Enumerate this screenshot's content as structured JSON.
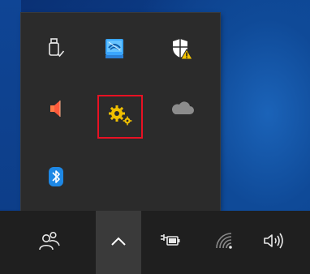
{
  "tray_overflow": {
    "icons": [
      {
        "name": "usb-safely-remove-icon"
      },
      {
        "name": "network-app-icon"
      },
      {
        "name": "windows-security-warning-icon"
      },
      {
        "name": "speaker-muted-icon"
      },
      {
        "name": "settings-gears-icon",
        "selected": true
      },
      {
        "name": "onedrive-cloud-icon"
      },
      {
        "name": "bluetooth-icon"
      }
    ],
    "highlight_color": "#e81123"
  },
  "taskbar": {
    "icons": [
      {
        "name": "people-icon"
      },
      {
        "name": "show-hidden-icons-chevron-up-icon",
        "active": true
      },
      {
        "name": "power-battery-icon"
      },
      {
        "name": "wifi-icon"
      },
      {
        "name": "volume-icon"
      }
    ]
  },
  "colors": {
    "flyout_bg": "#2b2b2b",
    "taskbar_bg": "#1f1f1f",
    "desktop_blue": "#0c3f8c",
    "gear_yellow": "#f0c000",
    "shield_white": "#ffffff",
    "warning_yellow": "#f5c400",
    "bluetooth_blue": "#1e88e5"
  }
}
